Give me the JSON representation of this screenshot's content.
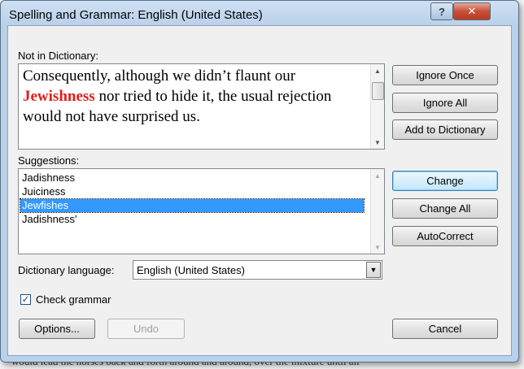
{
  "dialog": {
    "title": "Spelling and Grammar: English (United States)",
    "help_glyph": "?",
    "close_glyph": "✕"
  },
  "not_in_dictionary": {
    "label": "Not in Dictionary:",
    "text_before": "Consequently, although we didn’t flaunt our",
    "error_word": "Jewishness",
    "text_after": " nor tried to hide it, the usual rejection would not have surprised us."
  },
  "suggestions": {
    "label": "Suggestions:",
    "items": [
      "Jadishness",
      "Juiciness",
      "Jewfishes",
      "Jadishness'"
    ],
    "selected_index": 2
  },
  "buttons": {
    "ignore_once": "Ignore Once",
    "ignore_all": "Ignore All",
    "add_to_dictionary": "Add to Dictionary",
    "change": "Change",
    "change_all": "Change All",
    "autocorrect": "AutoCorrect",
    "options": "Options...",
    "undo": "Undo",
    "cancel": "Cancel"
  },
  "dictionary_language": {
    "label": "Dictionary language:",
    "value": "English (United States)"
  },
  "check_grammar": {
    "label": "Check grammar",
    "checked": true
  },
  "background_text": "would lead the horses back and forth around and around, over the mixture until all"
}
